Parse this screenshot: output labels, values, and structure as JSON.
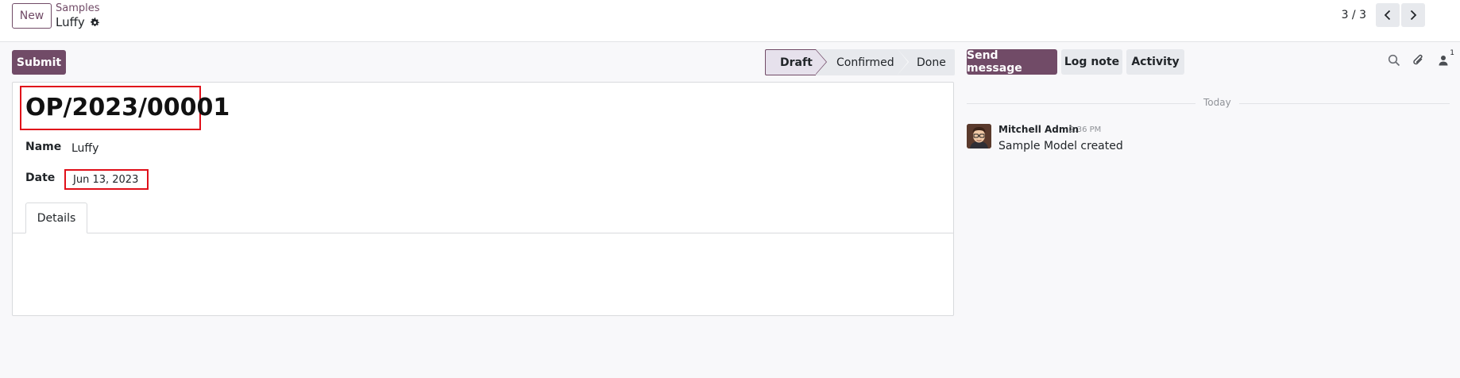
{
  "control_panel": {
    "new_label": "New",
    "breadcrumb_parent": "Samples",
    "breadcrumb_current": "Luffy",
    "pager_value": "3 / 3"
  },
  "form": {
    "submit_label": "Submit",
    "stages": [
      "Draft",
      "Confirmed",
      "Done"
    ],
    "active_stage": "Draft",
    "reference": "OP/2023/00001",
    "fields": {
      "name_label": "Name",
      "name_value": "Luffy",
      "date_label": "Date",
      "date_value": "Jun 13, 2023"
    },
    "tabs": [
      "Details"
    ],
    "annotation_color": "#e0101a"
  },
  "chatter": {
    "send_message_label": "Send message",
    "log_note_label": "Log note",
    "activity_label": "Activity",
    "follower_count": "1",
    "day_separator": "Today",
    "messages": [
      {
        "author": "Mitchell Admin",
        "time": "2:36 PM",
        "body": "Sample Model created"
      }
    ],
    "icons": [
      "search-icon",
      "paperclip-icon",
      "follower-icon"
    ]
  },
  "colors": {
    "brand": "#714b67",
    "button_secondary": "#e7e9ed"
  }
}
